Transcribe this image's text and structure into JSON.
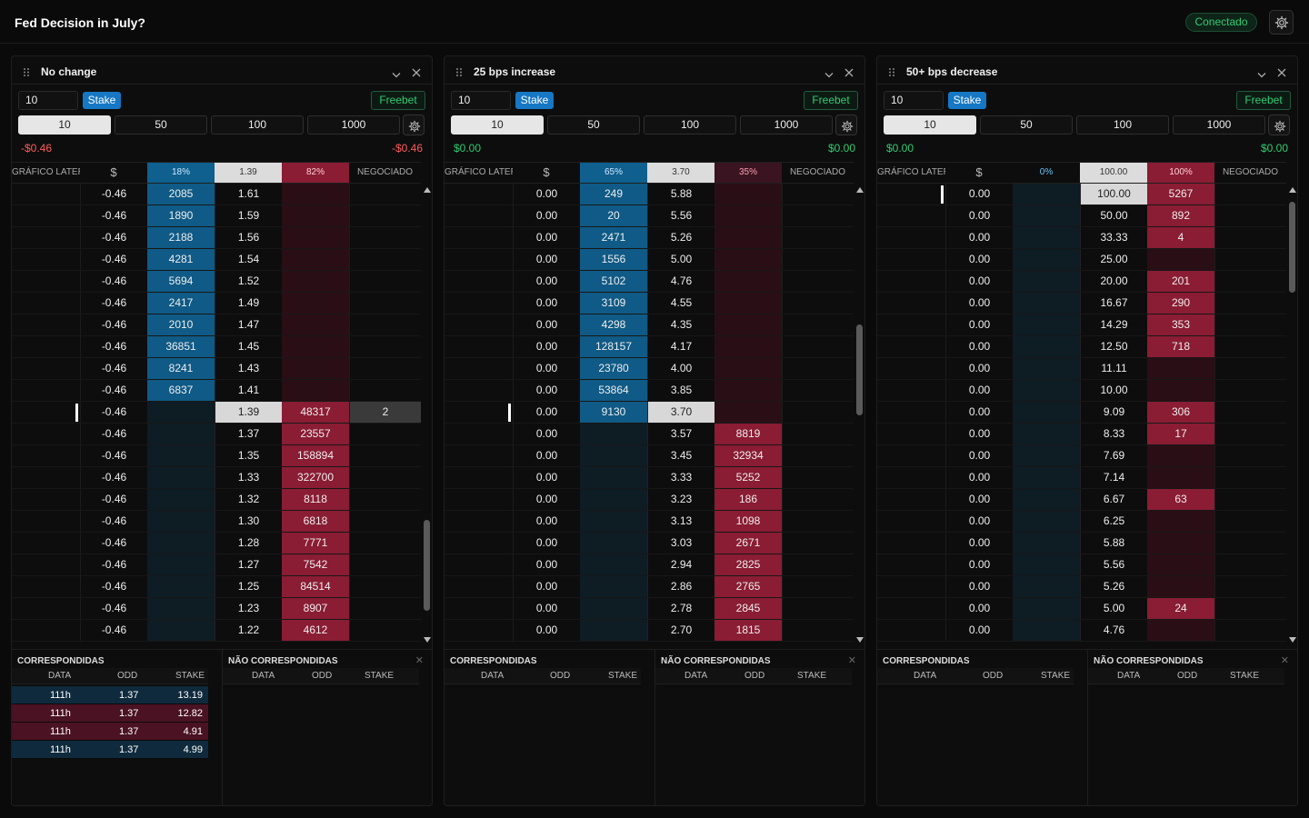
{
  "app": {
    "title": "Fed Decision in July?",
    "status": "Conectado",
    "status_color": "#2ecc71",
    "settings_icon": "gear-icon"
  },
  "colors": {
    "back": "#0f5a86",
    "lay": "#8a1c33",
    "current_odd": "#d8d8d8",
    "accent": "#1677c4"
  },
  "panels": [
    {
      "title": "No change",
      "stake_value": "10",
      "stake_label": "Stake",
      "freebet_label": "Freebet",
      "presets": [
        "10",
        "50",
        "100",
        "1000"
      ],
      "active_preset": 0,
      "pl_left": "-$0.46",
      "pl_right": "-$0.46",
      "pl_negative": true,
      "headers": {
        "graph": "GRÁFICO LATERAL",
        "currency": "$",
        "back_pct": "18%",
        "odd": "1.39",
        "lay_pct": "82%",
        "traded": "NEGOCIADO"
      },
      "rows": [
        {
          "pl": "-0.46",
          "back": "2085",
          "odd": "1.61",
          "lay": "",
          "traded": ""
        },
        {
          "pl": "-0.46",
          "back": "1890",
          "odd": "1.59",
          "lay": "",
          "traded": ""
        },
        {
          "pl": "-0.46",
          "back": "2188",
          "odd": "1.56",
          "lay": "",
          "traded": ""
        },
        {
          "pl": "-0.46",
          "back": "4281",
          "odd": "1.54",
          "lay": "",
          "traded": ""
        },
        {
          "pl": "-0.46",
          "back": "5694",
          "odd": "1.52",
          "lay": "",
          "traded": ""
        },
        {
          "pl": "-0.46",
          "back": "2417",
          "odd": "1.49",
          "lay": "",
          "traded": ""
        },
        {
          "pl": "-0.46",
          "back": "2010",
          "odd": "1.47",
          "lay": "",
          "traded": ""
        },
        {
          "pl": "-0.46",
          "back": "36851",
          "odd": "1.45",
          "lay": "",
          "traded": ""
        },
        {
          "pl": "-0.46",
          "back": "8241",
          "odd": "1.43",
          "lay": "",
          "traded": ""
        },
        {
          "pl": "-0.46",
          "back": "6837",
          "odd": "1.41",
          "lay": "",
          "traded": ""
        },
        {
          "pl": "-0.46",
          "back": "",
          "odd": "1.39",
          "lay": "48317",
          "traded": "2",
          "current": true
        },
        {
          "pl": "-0.46",
          "back": "",
          "odd": "1.37",
          "lay": "23557",
          "traded": ""
        },
        {
          "pl": "-0.46",
          "back": "",
          "odd": "1.35",
          "lay": "158894",
          "traded": ""
        },
        {
          "pl": "-0.46",
          "back": "",
          "odd": "1.33",
          "lay": "322700",
          "traded": ""
        },
        {
          "pl": "-0.46",
          "back": "",
          "odd": "1.32",
          "lay": "8118",
          "traded": ""
        },
        {
          "pl": "-0.46",
          "back": "",
          "odd": "1.30",
          "lay": "6818",
          "traded": ""
        },
        {
          "pl": "-0.46",
          "back": "",
          "odd": "1.28",
          "lay": "7771",
          "traded": ""
        },
        {
          "pl": "-0.46",
          "back": "",
          "odd": "1.27",
          "lay": "7542",
          "traded": ""
        },
        {
          "pl": "-0.46",
          "back": "",
          "odd": "1.25",
          "lay": "84514",
          "traded": ""
        },
        {
          "pl": "-0.46",
          "back": "",
          "odd": "1.23",
          "lay": "8907",
          "traded": ""
        },
        {
          "pl": "-0.46",
          "back": "",
          "odd": "1.22",
          "lay": "4612",
          "traded": ""
        }
      ],
      "matched_title": "CORRESPONDIDAS",
      "unmatched_title": "NÃO CORRESPONDIDAS",
      "cols": [
        "DATA",
        "ODD",
        "STAKE"
      ],
      "matched": [
        {
          "data": "111h",
          "odd": "1.37",
          "stake": "13.19",
          "side": "back"
        },
        {
          "data": "111h",
          "odd": "1.37",
          "stake": "12.82",
          "side": "lay"
        },
        {
          "data": "111h",
          "odd": "1.37",
          "stake": "4.91",
          "side": "lay"
        },
        {
          "data": "111h",
          "odd": "1.37",
          "stake": "4.99",
          "side": "back"
        }
      ]
    },
    {
      "title": "25 bps increase",
      "stake_value": "10",
      "stake_label": "Stake",
      "freebet_label": "Freebet",
      "presets": [
        "10",
        "50",
        "100",
        "1000"
      ],
      "active_preset": 0,
      "pl_left": "$0.00",
      "pl_right": "$0.00",
      "pl_negative": false,
      "headers": {
        "graph": "GRÁFICO LATERAL",
        "currency": "$",
        "back_pct": "65%",
        "odd": "3.70",
        "lay_pct": "35%",
        "traded": "NEGOCIADO"
      },
      "rows": [
        {
          "pl": "0.00",
          "back": "249",
          "odd": "5.88",
          "lay": "",
          "traded": ""
        },
        {
          "pl": "0.00",
          "back": "20",
          "odd": "5.56",
          "lay": "",
          "traded": ""
        },
        {
          "pl": "0.00",
          "back": "2471",
          "odd": "5.26",
          "lay": "",
          "traded": ""
        },
        {
          "pl": "0.00",
          "back": "1556",
          "odd": "5.00",
          "lay": "",
          "traded": ""
        },
        {
          "pl": "0.00",
          "back": "5102",
          "odd": "4.76",
          "lay": "",
          "traded": ""
        },
        {
          "pl": "0.00",
          "back": "3109",
          "odd": "4.55",
          "lay": "",
          "traded": ""
        },
        {
          "pl": "0.00",
          "back": "4298",
          "odd": "4.35",
          "lay": "",
          "traded": ""
        },
        {
          "pl": "0.00",
          "back": "128157",
          "odd": "4.17",
          "lay": "",
          "traded": ""
        },
        {
          "pl": "0.00",
          "back": "23780",
          "odd": "4.00",
          "lay": "",
          "traded": ""
        },
        {
          "pl": "0.00",
          "back": "53864",
          "odd": "3.85",
          "lay": "",
          "traded": ""
        },
        {
          "pl": "0.00",
          "back": "9130",
          "odd": "3.70",
          "lay": "",
          "traded": "",
          "current": true
        },
        {
          "pl": "0.00",
          "back": "",
          "odd": "3.57",
          "lay": "8819",
          "traded": ""
        },
        {
          "pl": "0.00",
          "back": "",
          "odd": "3.45",
          "lay": "32934",
          "traded": ""
        },
        {
          "pl": "0.00",
          "back": "",
          "odd": "3.33",
          "lay": "5252",
          "traded": ""
        },
        {
          "pl": "0.00",
          "back": "",
          "odd": "3.23",
          "lay": "186",
          "traded": ""
        },
        {
          "pl": "0.00",
          "back": "",
          "odd": "3.13",
          "lay": "1098",
          "traded": ""
        },
        {
          "pl": "0.00",
          "back": "",
          "odd": "3.03",
          "lay": "2671",
          "traded": ""
        },
        {
          "pl": "0.00",
          "back": "",
          "odd": "2.94",
          "lay": "2825",
          "traded": ""
        },
        {
          "pl": "0.00",
          "back": "",
          "odd": "2.86",
          "lay": "2765",
          "traded": ""
        },
        {
          "pl": "0.00",
          "back": "",
          "odd": "2.78",
          "lay": "2845",
          "traded": ""
        },
        {
          "pl": "0.00",
          "back": "",
          "odd": "2.70",
          "lay": "1815",
          "traded": ""
        }
      ],
      "matched_title": "CORRESPONDIDAS",
      "unmatched_title": "NÃO CORRESPONDIDAS",
      "cols": [
        "DATA",
        "ODD",
        "STAKE"
      ],
      "matched": []
    },
    {
      "title": "50+ bps decrease",
      "stake_value": "10",
      "stake_label": "Stake",
      "freebet_label": "Freebet",
      "presets": [
        "10",
        "50",
        "100",
        "1000"
      ],
      "active_preset": 0,
      "pl_left": "$0.00",
      "pl_right": "$0.00",
      "pl_negative": false,
      "headers": {
        "graph": "GRÁFICO LATERAL",
        "currency": "$",
        "back_pct": "0%",
        "odd": "100.00",
        "lay_pct": "100%",
        "traded": "NEGOCIADO"
      },
      "rows": [
        {
          "pl": "0.00",
          "back": "",
          "odd": "100.00",
          "lay": "5267",
          "traded": "",
          "current": true
        },
        {
          "pl": "0.00",
          "back": "",
          "odd": "50.00",
          "lay": "892",
          "traded": ""
        },
        {
          "pl": "0.00",
          "back": "",
          "odd": "33.33",
          "lay": "4",
          "traded": ""
        },
        {
          "pl": "0.00",
          "back": "",
          "odd": "25.00",
          "lay": "",
          "traded": ""
        },
        {
          "pl": "0.00",
          "back": "",
          "odd": "20.00",
          "lay": "201",
          "traded": ""
        },
        {
          "pl": "0.00",
          "back": "",
          "odd": "16.67",
          "lay": "290",
          "traded": ""
        },
        {
          "pl": "0.00",
          "back": "",
          "odd": "14.29",
          "lay": "353",
          "traded": ""
        },
        {
          "pl": "0.00",
          "back": "",
          "odd": "12.50",
          "lay": "718",
          "traded": ""
        },
        {
          "pl": "0.00",
          "back": "",
          "odd": "11.11",
          "lay": "",
          "traded": ""
        },
        {
          "pl": "0.00",
          "back": "",
          "odd": "10.00",
          "lay": "",
          "traded": ""
        },
        {
          "pl": "0.00",
          "back": "",
          "odd": "9.09",
          "lay": "306",
          "traded": ""
        },
        {
          "pl": "0.00",
          "back": "",
          "odd": "8.33",
          "lay": "17",
          "traded": ""
        },
        {
          "pl": "0.00",
          "back": "",
          "odd": "7.69",
          "lay": "",
          "traded": ""
        },
        {
          "pl": "0.00",
          "back": "",
          "odd": "7.14",
          "lay": "",
          "traded": ""
        },
        {
          "pl": "0.00",
          "back": "",
          "odd": "6.67",
          "lay": "63",
          "traded": ""
        },
        {
          "pl": "0.00",
          "back": "",
          "odd": "6.25",
          "lay": "",
          "traded": ""
        },
        {
          "pl": "0.00",
          "back": "",
          "odd": "5.88",
          "lay": "",
          "traded": ""
        },
        {
          "pl": "0.00",
          "back": "",
          "odd": "5.56",
          "lay": "",
          "traded": ""
        },
        {
          "pl": "0.00",
          "back": "",
          "odd": "5.26",
          "lay": "",
          "traded": ""
        },
        {
          "pl": "0.00",
          "back": "",
          "odd": "5.00",
          "lay": "24",
          "traded": ""
        },
        {
          "pl": "0.00",
          "back": "",
          "odd": "4.76",
          "lay": "",
          "traded": ""
        }
      ],
      "matched_title": "CORRESPONDIDAS",
      "unmatched_title": "NÃO CORRESPONDIDAS",
      "cols": [
        "DATA",
        "ODD",
        "STAKE"
      ],
      "matched": []
    }
  ]
}
